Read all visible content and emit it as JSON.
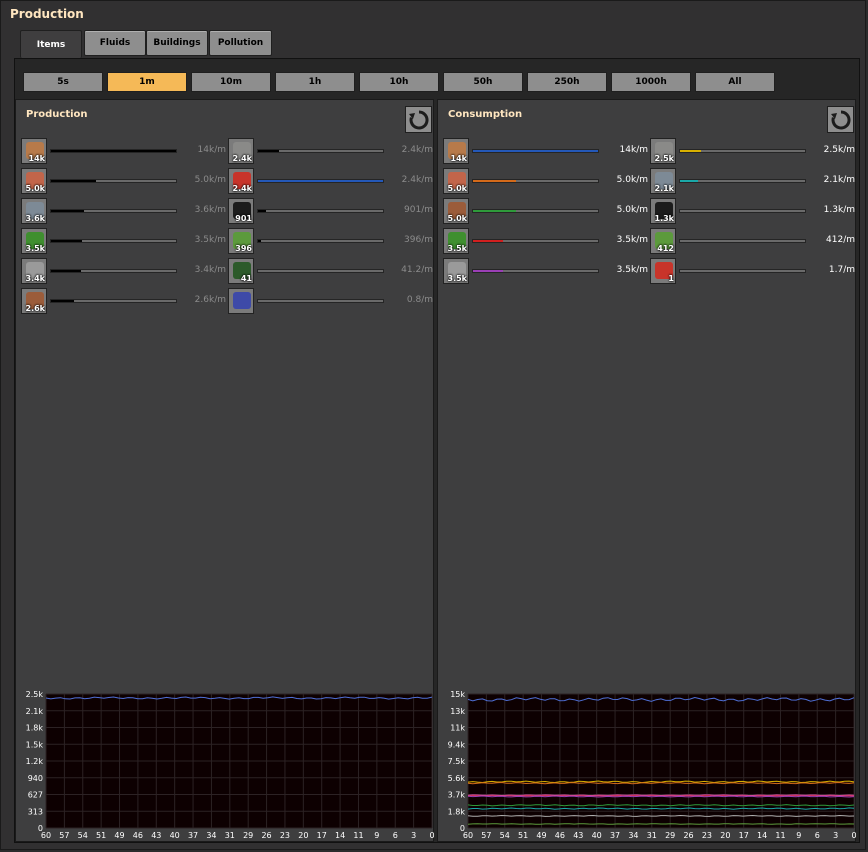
{
  "window": {
    "title": "Production"
  },
  "tabs": [
    {
      "label": "Items",
      "active": true
    },
    {
      "label": "Fluids",
      "active": false
    },
    {
      "label": "Buildings",
      "active": false
    },
    {
      "label": "Pollution",
      "active": false
    }
  ],
  "time_buttons": [
    {
      "label": "5s",
      "active": false
    },
    {
      "label": "1m",
      "active": true
    },
    {
      "label": "10m",
      "active": false
    },
    {
      "label": "1h",
      "active": false
    },
    {
      "label": "10h",
      "active": false
    },
    {
      "label": "50h",
      "active": false
    },
    {
      "label": "250h",
      "active": false
    },
    {
      "label": "1000h",
      "active": false
    },
    {
      "label": "All",
      "active": false
    }
  ],
  "production": {
    "title": "Production",
    "items": [
      {
        "icon": "copper-ore-icon",
        "color": "#b77a4a",
        "count": "14k",
        "rate": "14k/m",
        "fill": 1.0,
        "bar_color": "#000000"
      },
      {
        "icon": "copper-plate-icon",
        "color": "#c2654a",
        "count": "5.0k",
        "rate": "5.0k/m",
        "fill": 0.36,
        "bar_color": "#000000"
      },
      {
        "icon": "iron-ore-icon",
        "color": "#7d8a96",
        "count": "3.6k",
        "rate": "3.6k/m",
        "fill": 0.26,
        "bar_color": "#000000"
      },
      {
        "icon": "electronic-circuit-icon",
        "color": "#3f8f2f",
        "count": "3.5k",
        "rate": "3.5k/m",
        "fill": 0.25,
        "bar_color": "#000000"
      },
      {
        "icon": "iron-plate-icon",
        "color": "#9a9a9a",
        "count": "3.4k",
        "rate": "3.4k/m",
        "fill": 0.24,
        "bar_color": "#000000"
      },
      {
        "icon": "copper-ore-chunk-icon",
        "color": "#9b5c3a",
        "count": "2.6k",
        "rate": "2.6k/m",
        "fill": 0.18,
        "bar_color": "#000000"
      },
      {
        "icon": "stone-icon",
        "color": "#8a8a88",
        "count": "2.4k",
        "rate": "2.4k/m",
        "fill": 0.17,
        "bar_color": "#000000"
      },
      {
        "icon": "advanced-circuit-icon",
        "color": "#c8342a",
        "count": "2.4k",
        "rate": "2.4k/m",
        "fill": 1.0,
        "bar_color": "#2458b8"
      },
      {
        "icon": "coal-icon",
        "color": "#1c1c1c",
        "count": "901",
        "rate": "901/m",
        "fill": 0.06,
        "bar_color": "#000000"
      },
      {
        "icon": "wood-icon",
        "color": "#5c9a3c",
        "count": "396",
        "rate": "396/m",
        "fill": 0.02,
        "bar_color": "#000000"
      },
      {
        "icon": "green-rock-icon",
        "color": "#2c5a2a",
        "count": "41",
        "rate": "41.2/m",
        "fill": 0.0,
        "bar_color": "#000000"
      },
      {
        "icon": "processing-unit-icon",
        "color": "#3e4aa8",
        "count": "",
        "rate": "0.8/m",
        "fill": 0.0,
        "bar_color": "#000000"
      }
    ],
    "graph": {
      "y_labels": [
        "2.5k",
        "2.1k",
        "1.8k",
        "1.5k",
        "1.2k",
        "940",
        "627",
        "313",
        "0"
      ],
      "x_labels": [
        "60",
        "57",
        "54",
        "51",
        "49",
        "46",
        "43",
        "40",
        "37",
        "34",
        "31",
        "29",
        "26",
        "23",
        "20",
        "17",
        "14",
        "11",
        "9",
        "6",
        "3",
        "0"
      ]
    }
  },
  "consumption": {
    "title": "Consumption",
    "items": [
      {
        "icon": "copper-ore-icon",
        "color": "#b77a4a",
        "count": "14k",
        "rate": "14k/m",
        "fill": 1.0,
        "bar_color": "#2458b8"
      },
      {
        "icon": "copper-plate-icon",
        "color": "#c2654a",
        "count": "5.0k",
        "rate": "5.0k/m",
        "fill": 0.34,
        "bar_color": "#d46a1a"
      },
      {
        "icon": "copper-ore-chunk-icon",
        "color": "#9b5c3a",
        "count": "5.0k",
        "rate": "5.0k/m",
        "fill": 0.34,
        "bar_color": "#2e9a3a"
      },
      {
        "icon": "electronic-circuit-icon",
        "color": "#3f8f2f",
        "count": "3.5k",
        "rate": "3.5k/m",
        "fill": 0.24,
        "bar_color": "#d11f1f"
      },
      {
        "icon": "iron-plate-icon",
        "color": "#9a9a9a",
        "count": "3.5k",
        "rate": "3.5k/m",
        "fill": 0.24,
        "bar_color": "#9a3fb5"
      },
      {
        "icon": "stone-icon",
        "color": "#8a8a88",
        "count": "2.5k",
        "rate": "2.5k/m",
        "fill": 0.17,
        "bar_color": "#d8b000"
      },
      {
        "icon": "iron-ore-icon",
        "color": "#7d8a96",
        "count": "2.1k",
        "rate": "2.1k/m",
        "fill": 0.14,
        "bar_color": "#1aa8a8"
      },
      {
        "icon": "coal-icon",
        "color": "#1c1c1c",
        "count": "1.3k",
        "rate": "1.3k/m",
        "fill": 0.0,
        "bar_color": "#000000"
      },
      {
        "icon": "wood-icon",
        "color": "#5c9a3c",
        "count": "412",
        "rate": "412/m",
        "fill": 0.0,
        "bar_color": "#000000"
      },
      {
        "icon": "advanced-circuit-icon",
        "color": "#c8342a",
        "count": "1",
        "rate": "1.7/m",
        "fill": 0.0,
        "bar_color": "#000000"
      }
    ],
    "graph": {
      "y_labels": [
        "15k",
        "13k",
        "11k",
        "9.4k",
        "7.5k",
        "5.6k",
        "3.7k",
        "1.8k",
        "0"
      ],
      "x_labels": [
        "60",
        "57",
        "54",
        "51",
        "49",
        "46",
        "43",
        "40",
        "37",
        "34",
        "31",
        "29",
        "26",
        "23",
        "20",
        "17",
        "14",
        "11",
        "9",
        "6",
        "3",
        "0"
      ]
    }
  },
  "colors": {
    "accent": "#f5b957",
    "title_text": "#ffe6c0",
    "button": "#8e8e8e",
    "graph_bg": "#0d0001"
  }
}
